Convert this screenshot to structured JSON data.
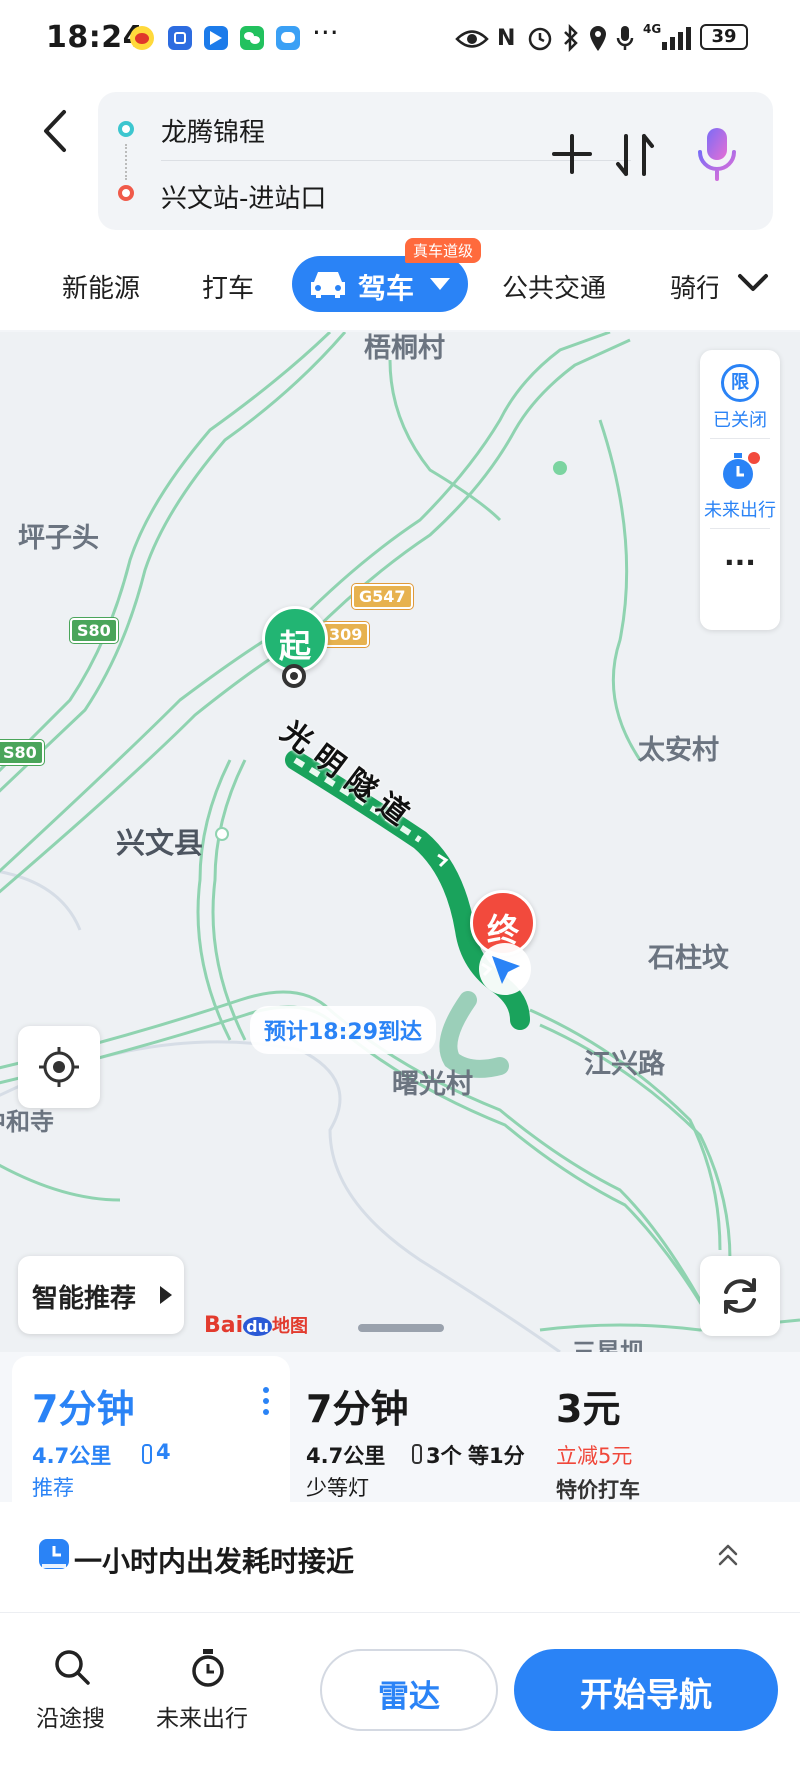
{
  "status_bar": {
    "time": "18:24",
    "network": "4G",
    "battery": "39"
  },
  "search": {
    "origin": "龙腾锦程",
    "destination": "兴文站-进站口"
  },
  "modes": {
    "new_energy": "新能源",
    "taxi": "打车",
    "drive": "驾车",
    "drive_badge": "真车道级",
    "transit": "公共交通",
    "cycling": "骑行"
  },
  "map": {
    "places": {
      "wutong": "梧桐村",
      "pingzitou": "坪子头",
      "taian": "太安村",
      "xingwen": "兴文县",
      "shizhuwen": "石柱坟",
      "jiangxing": "江兴路",
      "shuguang": "曙光村",
      "zhonghe": "中和寺",
      "sanxing": "三星坝"
    },
    "roads": {
      "tunnel": "光明隧道",
      "s80_a": "S80",
      "s80_b": "S80",
      "g547": "G547",
      "x309": "309"
    },
    "markers": {
      "start": "起",
      "end": "终"
    },
    "eta": "预计18:29到达",
    "right_panel": {
      "limit_icon": "限",
      "limit_label": "已关闭",
      "future_label": "未来出行",
      "more": "···"
    },
    "smart_recommend": "智能推荐",
    "logo": {
      "baidu": "Bai",
      "du": "du",
      "ditu": "地图"
    }
  },
  "routes": [
    {
      "time": "7分钟",
      "distance": "4.7公里",
      "lights": "4",
      "tag": "推荐"
    },
    {
      "time": "7分钟",
      "distance": "4.7公里",
      "lights": "3个",
      "wait": "等1分",
      "tag": "少等灯"
    },
    {
      "price": "3元",
      "discount": "立减5元",
      "tag": "特价打车"
    }
  ],
  "advice": {
    "text": "一小时内出发耗时接近"
  },
  "bottom": {
    "along_search": "沿途搜",
    "future_trip": "未来出行",
    "radar": "雷达",
    "start_nav": "开始导航"
  },
  "colors": {
    "accent": "#2a83f6",
    "route_green": "#1aa35c",
    "start_marker": "#22b573",
    "end_marker": "#f24a3d",
    "discount_red": "#f0473a"
  }
}
